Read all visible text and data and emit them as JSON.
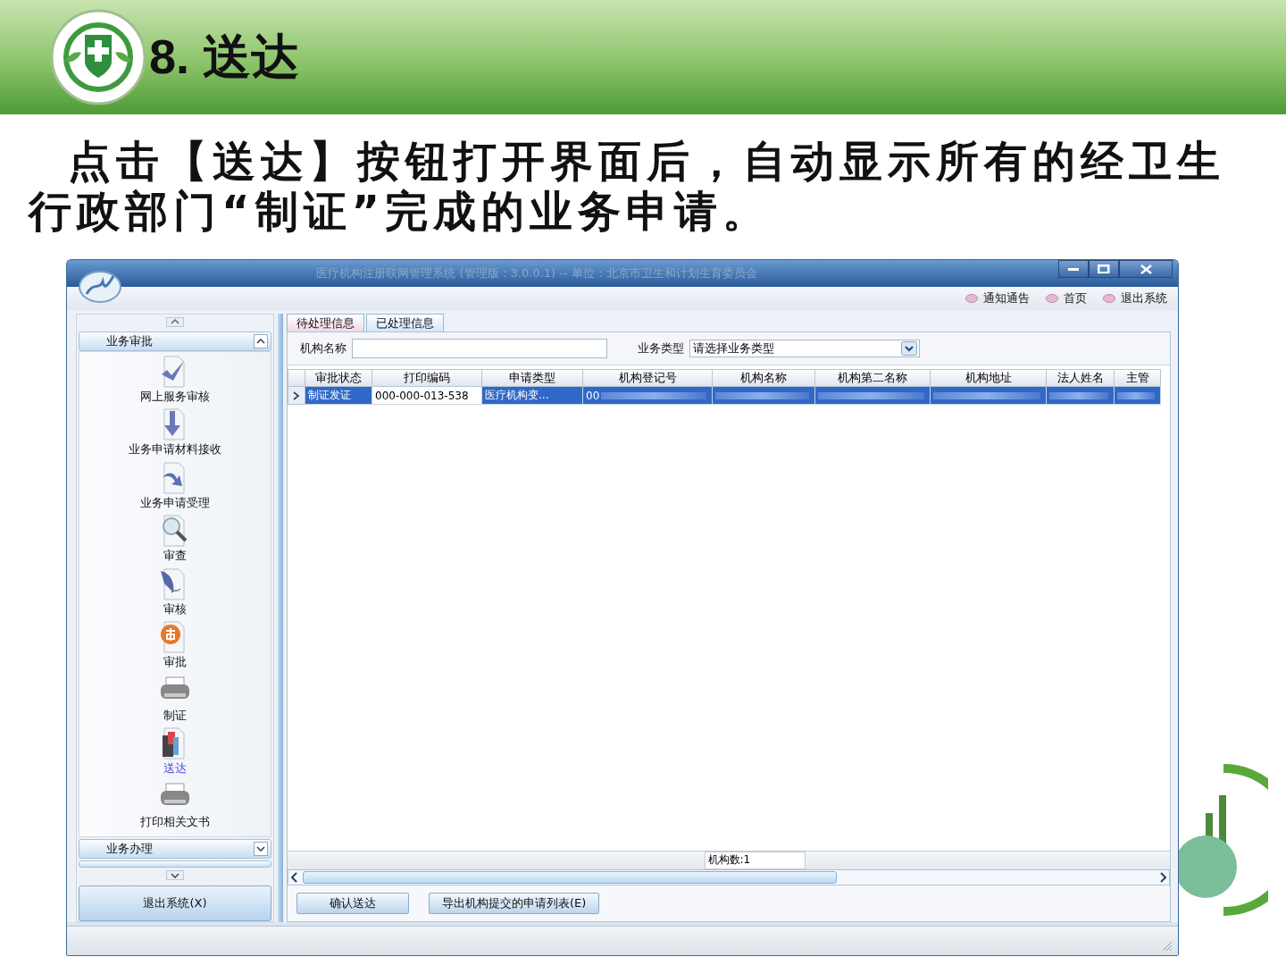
{
  "slide": {
    "title": "8. 送达",
    "paragraph": "点击【送达】按钮打开界面后，自动显示所有的经卫生行政部门“制证”完成的业务申请。"
  },
  "window": {
    "title": "医疗机构注册联网管理系统 (管理版：3.0.0.1) -- 单位：北京市卫生和计划生育委员会"
  },
  "top_links": [
    {
      "label": "通知通告"
    },
    {
      "label": "首页"
    },
    {
      "label": "退出系统"
    }
  ],
  "sidebar": {
    "groups": [
      {
        "title": "业务审批",
        "expanded": true,
        "items": [
          {
            "label": "网上服务审核",
            "selected": false
          },
          {
            "label": "业务申请材料接收",
            "selected": false
          },
          {
            "label": "业务申请受理",
            "selected": false
          },
          {
            "label": "审查",
            "selected": false
          },
          {
            "label": "审核",
            "selected": false
          },
          {
            "label": "审批",
            "selected": false
          },
          {
            "label": "制证",
            "selected": false
          },
          {
            "label": "送达",
            "selected": true
          },
          {
            "label": "打印相关文书",
            "selected": false
          }
        ]
      },
      {
        "title": "业务办理",
        "expanded": false
      }
    ],
    "exit_button": "退出系统(X)"
  },
  "tabs": [
    {
      "label": "待处理信息",
      "selected": true
    },
    {
      "label": "已处理信息",
      "selected": false
    }
  ],
  "filters": {
    "name_label": "机构名称",
    "type_label": "业务类型",
    "type_select": "请选择业务类型"
  },
  "table": {
    "columns": [
      "审批状态",
      "打印编码",
      "申请类型",
      "机构登记号",
      "机构名称",
      "机构第二名称",
      "机构地址",
      "法人姓名",
      "主管"
    ],
    "rows": [
      {
        "selected": true,
        "cells": [
          "制证发证",
          "000-000-013-538",
          "医疗机构变...",
          "00",
          "",
          "",
          "",
          "",
          ""
        ]
      }
    ],
    "count": "机构数:1"
  },
  "buttons": [
    "确认送达",
    "导出机构提交的申请列表(E)"
  ]
}
